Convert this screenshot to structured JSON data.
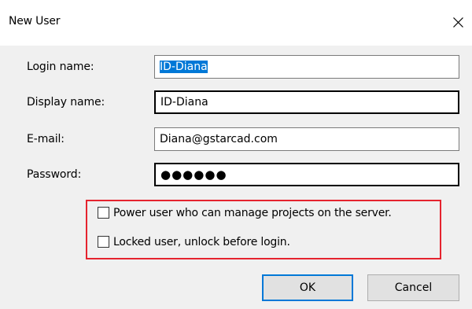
{
  "window": {
    "title": "New User",
    "close_icon": "close-icon"
  },
  "form": {
    "login_name": {
      "label": "Login name:",
      "value": "ID-Diana"
    },
    "display_name": {
      "label": "Display name:",
      "value": "ID-Diana"
    },
    "email": {
      "label": "E-mail:",
      "value": "Diana@gstarcad.com"
    },
    "password": {
      "label": "Password:",
      "value": "●●●●●●"
    }
  },
  "options": {
    "power_user": {
      "label": "Power user who can manage projects on the server.",
      "checked": false
    },
    "locked_user": {
      "label": "Locked user, unlock before login.",
      "checked": false
    }
  },
  "buttons": {
    "ok_label": "OK",
    "cancel_label": "Cancel"
  },
  "colors": {
    "highlight_border": "#e5232e",
    "selection": "#0078d7",
    "default_button_border": "#0078d7"
  }
}
